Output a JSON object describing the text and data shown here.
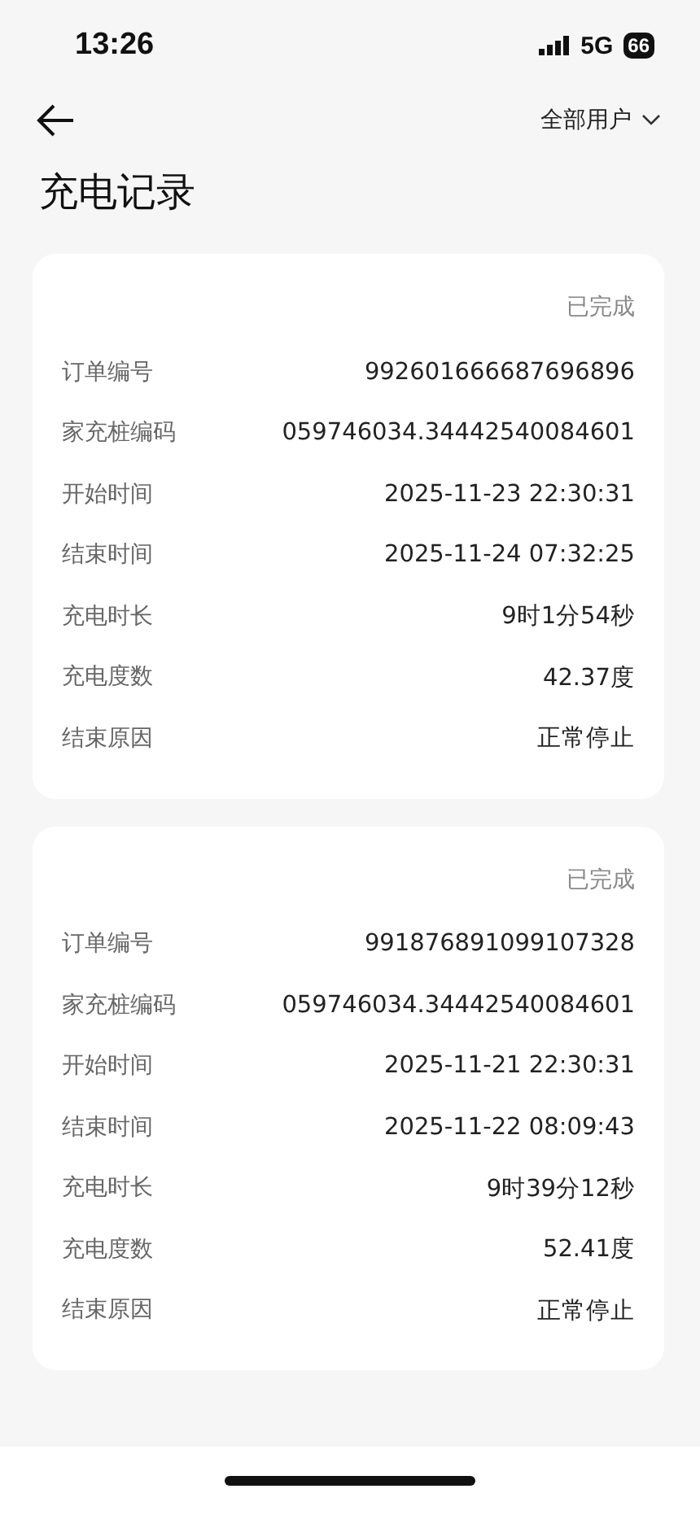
{
  "status_bar": {
    "time": "13:26",
    "network": "5G",
    "battery": "66"
  },
  "nav": {
    "filter": "全部用户"
  },
  "title": "充电记录",
  "records": [
    {
      "status": "已完成",
      "fields": [
        {
          "label": "订单编号",
          "value": "992601666687696896"
        },
        {
          "label": "家充桩编码",
          "value": "059746034.34442540084601"
        },
        {
          "label": "开始时间",
          "value": "2025-11-23 22:30:31"
        },
        {
          "label": "结束时间",
          "value": "2025-11-24 07:32:25"
        },
        {
          "label": "充电时长",
          "value": "9时1分54秒"
        },
        {
          "label": "充电度数",
          "value": "42.37度"
        },
        {
          "label": "结束原因",
          "value": "正常停止"
        }
      ]
    },
    {
      "status": "已完成",
      "fields": [
        {
          "label": "订单编号",
          "value": "991876891099107328"
        },
        {
          "label": "家充桩编码",
          "value": "059746034.34442540084601"
        },
        {
          "label": "开始时间",
          "value": "2025-11-21 22:30:31"
        },
        {
          "label": "结束时间",
          "value": "2025-11-22 08:09:43"
        },
        {
          "label": "充电时长",
          "value": "9时39分12秒"
        },
        {
          "label": "充电度数",
          "value": "52.41度"
        },
        {
          "label": "结束原因",
          "value": "正常停止"
        }
      ]
    }
  ]
}
